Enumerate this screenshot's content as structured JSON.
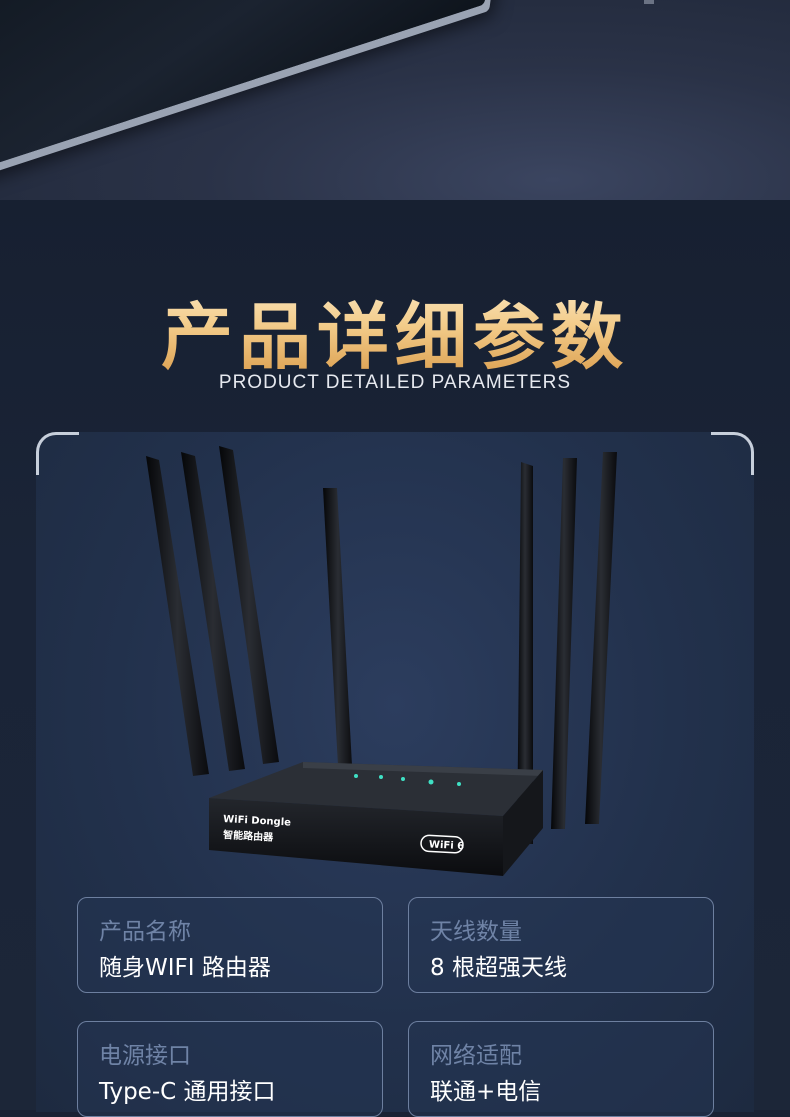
{
  "header": {
    "title_cn": "产品详细参数",
    "title_en": "PRODUCT DETAILED PARAMETERS"
  },
  "product_image": {
    "label_brand": "WiFi Dongle",
    "label_cn": "智能路由器",
    "badge": "WiFi 6",
    "antenna_count": 7
  },
  "specs": [
    {
      "label": "产品名称",
      "value": "随身WIFI 路由器"
    },
    {
      "label": "天线数量",
      "value": "8 根超强天线"
    },
    {
      "label": "电源接口",
      "value": "Type-C 通用接口"
    },
    {
      "label": "网络适配",
      "value": "联通+电信"
    }
  ],
  "colors": {
    "background": "#1a2234",
    "title_gold": "#f3cc8a",
    "card_border": "#6d7f9f",
    "label_color": "#6f83a6"
  }
}
